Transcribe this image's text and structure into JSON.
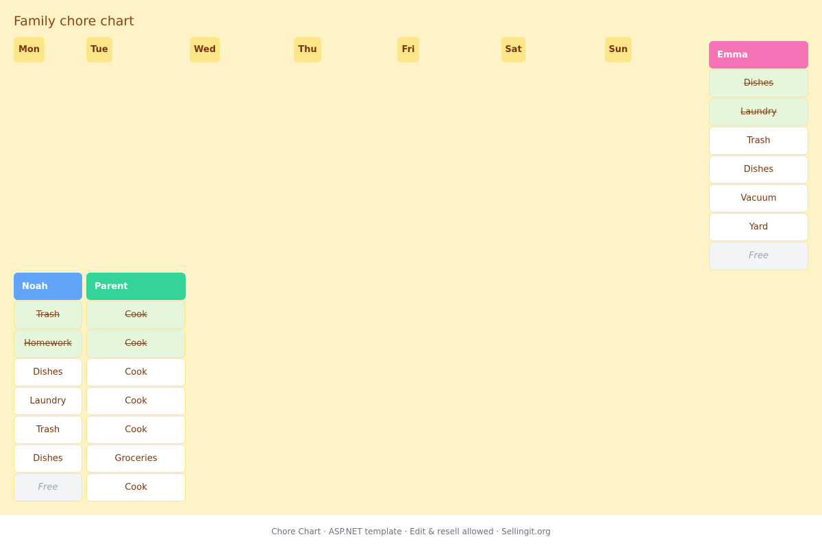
{
  "title": "Family chore chart",
  "days": [
    "Mon",
    "Tue",
    "Wed",
    "Thu",
    "Fri",
    "Sat",
    "Sun"
  ],
  "members": [
    {
      "name": "Emma",
      "color": "#f472b6",
      "tasks": [
        {
          "label": "Dishes",
          "state": "done"
        },
        {
          "label": "Laundry",
          "state": "done"
        },
        {
          "label": "Trash",
          "state": "todo"
        },
        {
          "label": "Dishes",
          "state": "todo"
        },
        {
          "label": "Vacuum",
          "state": "todo"
        },
        {
          "label": "Yard",
          "state": "todo"
        },
        {
          "label": "Free",
          "state": "free"
        }
      ]
    },
    {
      "name": "Noah",
      "color": "#60a5fa",
      "tasks": [
        {
          "label": "Trash",
          "state": "done"
        },
        {
          "label": "Homework",
          "state": "done"
        },
        {
          "label": "Dishes",
          "state": "todo"
        },
        {
          "label": "Laundry",
          "state": "todo"
        },
        {
          "label": "Trash",
          "state": "todo"
        },
        {
          "label": "Dishes",
          "state": "todo"
        },
        {
          "label": "Free",
          "state": "free"
        }
      ]
    },
    {
      "name": "Parent",
      "color": "#34d399",
      "tasks": [
        {
          "label": "Cook",
          "state": "done"
        },
        {
          "label": "Cook",
          "state": "done"
        },
        {
          "label": "Cook",
          "state": "todo"
        },
        {
          "label": "Cook",
          "state": "todo"
        },
        {
          "label": "Cook",
          "state": "todo"
        },
        {
          "label": "Groceries",
          "state": "todo"
        },
        {
          "label": "Cook",
          "state": "todo"
        }
      ]
    }
  ],
  "footer": "Chore Chart · ASP.NET template · Edit & resell allowed · Sellingit.org"
}
